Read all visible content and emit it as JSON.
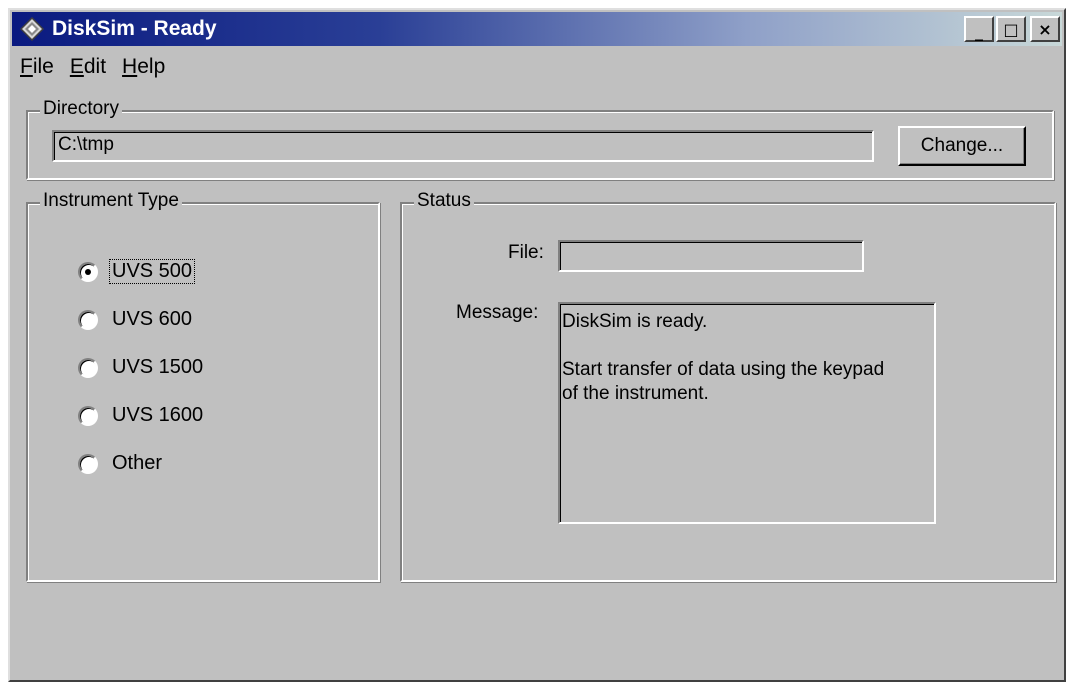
{
  "window": {
    "title": "DiskSim - Ready",
    "app_icon": "disksim-diamond-icon",
    "buttons": {
      "minimize": "_",
      "maximize": "□",
      "close": "×"
    }
  },
  "menu": {
    "items": [
      {
        "label": "File",
        "accel": "F",
        "rest": "ile"
      },
      {
        "label": "Edit",
        "accel": "E",
        "rest": "dit"
      },
      {
        "label": "Help",
        "accel": "H",
        "rest": "elp"
      }
    ]
  },
  "directory": {
    "legend": "Directory",
    "value": "C:\\tmp",
    "change_button": "Change..."
  },
  "instrument": {
    "legend": "Instrument Type",
    "options": [
      {
        "label": "UVS 500",
        "checked": true
      },
      {
        "label": "UVS 600",
        "checked": false
      },
      {
        "label": "UVS 1500",
        "checked": false
      },
      {
        "label": "UVS 1600",
        "checked": false
      },
      {
        "label": "Other",
        "checked": false
      }
    ]
  },
  "status": {
    "legend": "Status",
    "file_label": "File:",
    "file_value": "",
    "message_label": "Message:",
    "message_lines": [
      "DiskSim is ready.",
      "",
      "Start transfer of data using the keypad",
      "of the instrument."
    ]
  }
}
